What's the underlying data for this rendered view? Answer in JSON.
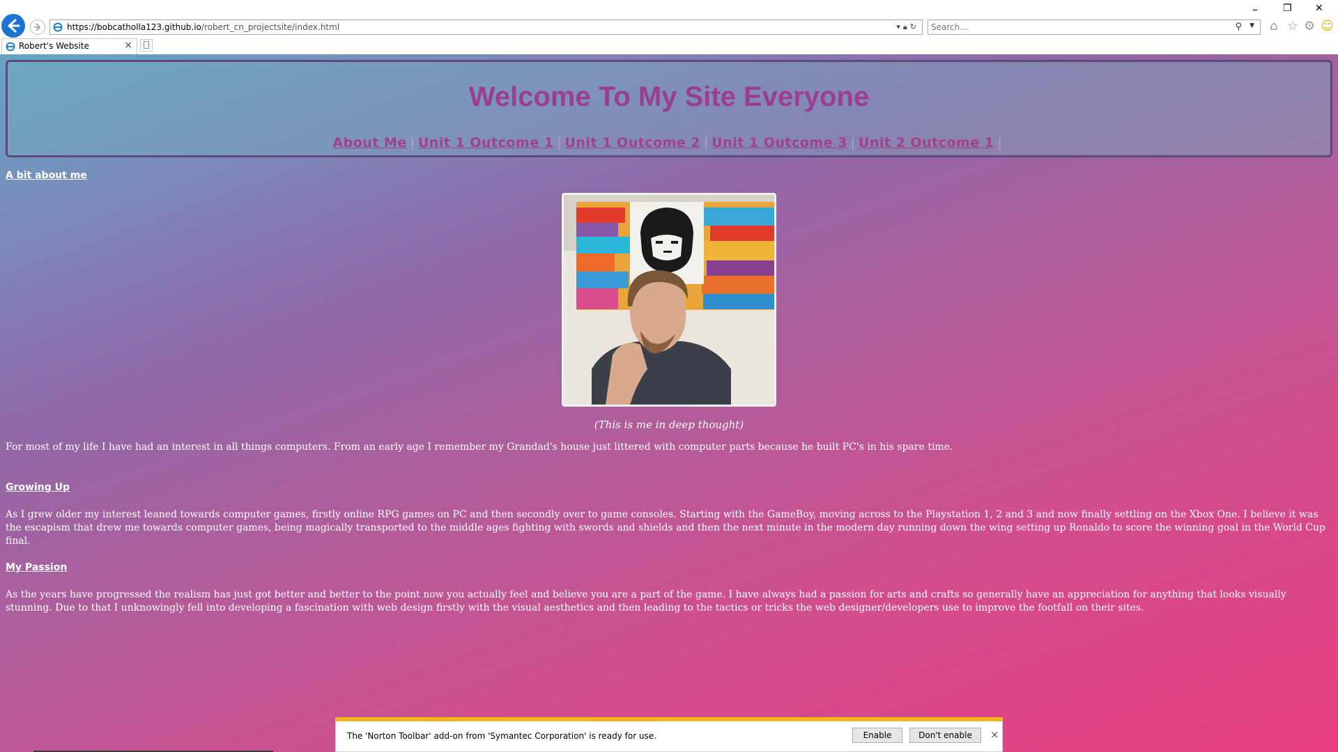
{
  "browser": {
    "url_host": "https://bobcatholla123.github.io",
    "url_path": "/robert_cn_projectsite/index.html",
    "search_placeholder": "Search...",
    "tab_title": "Robert's Website",
    "tab_close": "×"
  },
  "window_controls": {
    "minimize": "–",
    "restore": "❐",
    "close": "✕"
  },
  "site": {
    "title": "Welcome To My Site Everyone",
    "nav": [
      "About Me",
      "Unit 1 Outcome 1",
      "Unit 1 Outcome 2",
      "Unit 1 Outcome 3",
      "Unit 2 Outcome 1"
    ],
    "nav_separator": "|"
  },
  "content": {
    "heading_about": "A bit about me",
    "photo_caption": "(This is me in deep thought)",
    "intro": "For most of my life I have had an interest in all things computers. From an early age I remember my Grandad's house just littered with computer parts because he built PC's in his spare time.",
    "heading_growing": "Growing Up",
    "growing_text": "As I grew older my interest leaned towards computer games, firstly online RPG games on PC and then secondly over to game consoles. Starting with the GameBoy, moving across to the Playstation 1, 2 and 3 and now finally settling on the Xbox One. I believe it was the escapism that drew me towards computer games, being magically transported to the middle ages fighting with swords and shields and then the next minute in the modern day running down the wing setting up Ronaldo to score the winning goal in the World Cup final.",
    "heading_passion": "My Passion",
    "passion_text": "As the years have progressed the realism has just got better and better to the point now you actually feel and believe you are a part of the game. I have always had a passion for arts and crafts so generally have an appreciation for anything that looks visually stunning. Due to that I unknowingly fell into developing a fascination with web design firstly with the visual aesthetics and then leading to the tactics or tricks the web designer/developers use to improve the footfall on their sites."
  },
  "notification": {
    "message": "The 'Norton Toolbar' add-on from 'Symantec Corporation' is ready for use.",
    "enable_label": "Enable",
    "dont_enable_label": "Don't enable",
    "close": "×"
  },
  "colors": {
    "title": "#9b3d93",
    "nav_link": "#a33f8c",
    "notification_accent": "#f1b51d",
    "back_button": "#1c74d2"
  }
}
